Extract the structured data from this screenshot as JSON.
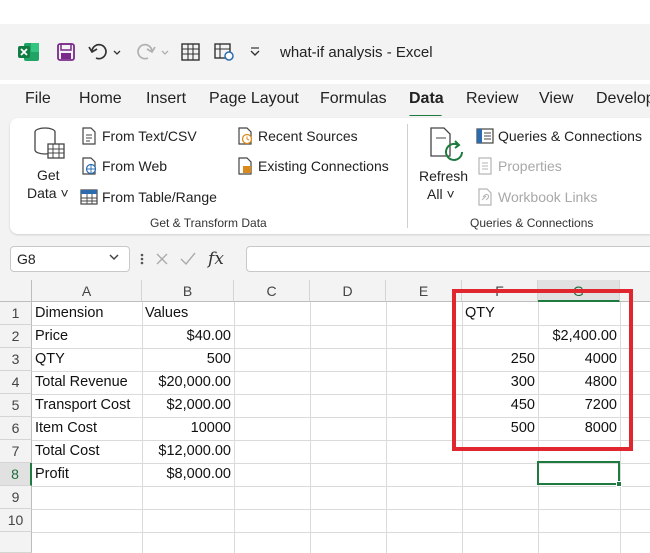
{
  "window": {
    "title": "what-if analysis  -  Excel"
  },
  "tabs": [
    "File",
    "Home",
    "Insert",
    "Page Layout",
    "Formulas",
    "Data",
    "Review",
    "View",
    "Develop"
  ],
  "active_tab": "Data",
  "ribbon": {
    "get_data": {
      "line1": "Get",
      "line2": "Data ˅"
    },
    "from_text_csv": "From Text/CSV",
    "from_web": "From Web",
    "from_table_range": "From Table/Range",
    "recent_sources": "Recent Sources",
    "existing_connections": "Existing Connections",
    "group1_label": "Get & Transform Data",
    "refresh_all": {
      "line1": "Refresh",
      "line2": "All ˅"
    },
    "queries_connections": "Queries & Connections",
    "properties": "Properties",
    "workbook_links": "Workbook Links",
    "group2_label": "Queries & Connections"
  },
  "formula_bar": {
    "name_box": "G8",
    "fx": "fx",
    "value": ""
  },
  "colors": {
    "accent": "#1f7a3f",
    "highlight": "#e0262f"
  },
  "grid": {
    "columns": [
      "A",
      "B",
      "C",
      "D",
      "E",
      "F",
      "G"
    ],
    "rows": [
      "1",
      "2",
      "3",
      "4",
      "5",
      "6",
      "7",
      "8",
      "9",
      "10"
    ],
    "cells": {
      "A1": "Dimension",
      "B1": "Values",
      "A2": "Price",
      "B2": "$40.00",
      "A3": "QTY",
      "B3": "500",
      "A4": "Total Revenue",
      "B4": "$20,000.00",
      "A5": "Transport Cost",
      "B5": "$2,000.00",
      "A6": "Item Cost",
      "B6": "10000",
      "A7": "Total Cost",
      "B7": "$12,000.00",
      "A8": "Profit",
      "B8": "$8,000.00",
      "F1": "QTY",
      "G2": "$2,400.00",
      "F3": "250",
      "G3": "4000",
      "F4": "300",
      "G4": "4800",
      "F5": "450",
      "G5": "7200",
      "F6": "500",
      "G6": "8000"
    }
  }
}
